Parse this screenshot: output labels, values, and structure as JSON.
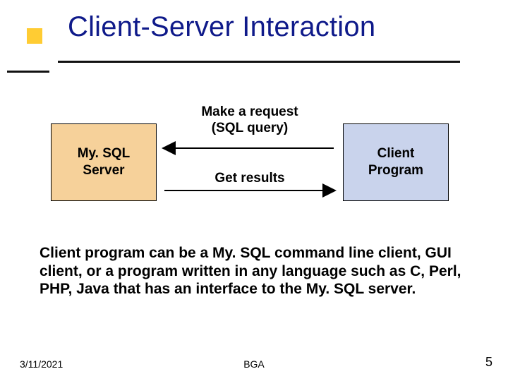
{
  "title": "Client-Server Interaction",
  "diagram": {
    "server_label": "My. SQL\nServer",
    "client_label": "Client\nProgram",
    "request_label": "Make a request\n(SQL query)",
    "results_label": "Get results"
  },
  "description": "Client program can be a My. SQL command line client, GUI client, or a program written in any language such as C, Perl, PHP, Java that has an interface to the My. SQL server.",
  "footer": {
    "date": "3/11/2021",
    "center": "BGA",
    "page": "5"
  },
  "colors": {
    "title": "#0f1a8a",
    "server_box": "#f6d19a",
    "client_box": "#c9d3ec",
    "bullet": "#ffcc33"
  }
}
